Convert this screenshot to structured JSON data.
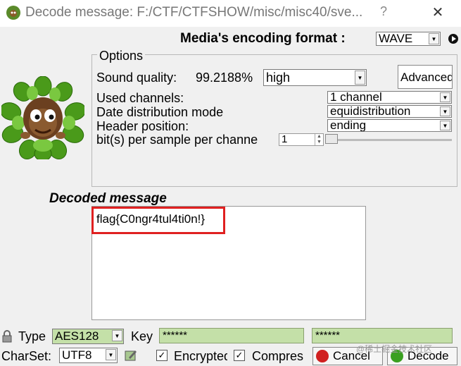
{
  "window": {
    "title": "Decode message: F:/CTF/CTFSHOW/misc/misc40/sve...",
    "help": "?",
    "close": "✕"
  },
  "encoding": {
    "label": "Media's encoding format :",
    "value": "WAVE"
  },
  "options": {
    "legend": "Options",
    "sound_quality_label": "Sound quality:",
    "sound_quality_value": "99.2188%",
    "sound_quality_select": "high",
    "advanced_button": "Advanced",
    "used_channels_label": "Used channels:",
    "used_channels_value": "1 channel",
    "distribution_label": "Date distribution mode",
    "distribution_value": "equidistribution",
    "header_position_label": "Header position:",
    "header_position_value": "ending",
    "bits_label": "bit(s) per sample per channe",
    "bits_value": "1"
  },
  "decoded": {
    "title": "Decoded message",
    "text": "flag{C0ngr4tul4ti0n!}"
  },
  "bottom": {
    "type_label": "Type",
    "type_value": "AES128",
    "key_label": "Key",
    "key_value": "******",
    "key_confirm_value": "******",
    "charset_label": "CharSet:",
    "charset_value": "UTF8",
    "encrypted_label": "Encrypted",
    "compressed_label": "Compres",
    "cancel_button": "Cancel",
    "decode_button": "Decode",
    "watermark": "@稀土掘金技术社区"
  },
  "colors": {
    "highlight": "#e02020",
    "key_field": "#c4e0a8"
  }
}
